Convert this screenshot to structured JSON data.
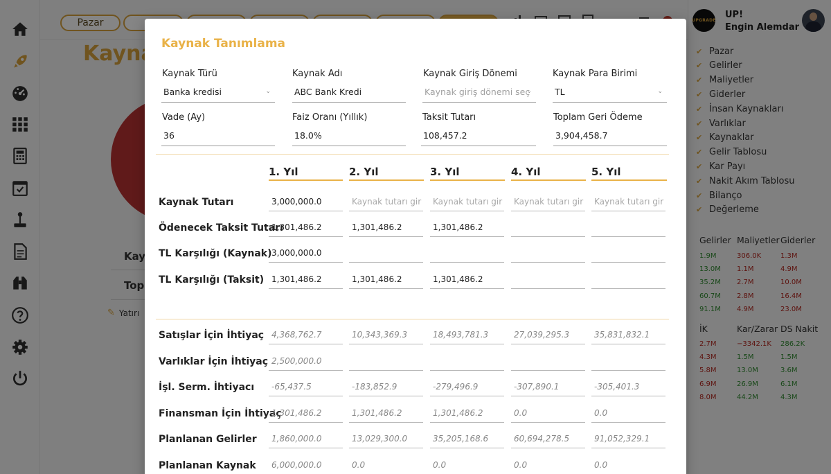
{
  "app": {
    "org": "UP!",
    "user_name": "Engin Alemdar",
    "logo_text": "UPGRADE"
  },
  "top_tabs": [
    {
      "label": "Pazar"
    },
    {
      "label": ""
    },
    {
      "label": ""
    },
    {
      "label": ""
    },
    {
      "label": ""
    },
    {
      "label": ""
    },
    {
      "label": ""
    }
  ],
  "background": {
    "title": "Kaynak",
    "text1": "Kay",
    "text2": "Topl",
    "text3": "Yatırı"
  },
  "sidebar_nav": [
    {
      "label": "Pazar"
    },
    {
      "label": "Gelirler"
    },
    {
      "label": "Maliyetler"
    },
    {
      "label": "Giderler"
    },
    {
      "label": "İnsan Kaynakları"
    },
    {
      "label": "Varlıklar"
    },
    {
      "label": "Kaynaklar"
    },
    {
      "label": "Gelir Tablosu"
    },
    {
      "label": "Kar Payı"
    },
    {
      "label": "Nakit Akım Tablosu"
    },
    {
      "label": "Bilanço"
    },
    {
      "label": "Değerleme"
    }
  ],
  "summary1": {
    "headers": [
      "Gelirler",
      "Maliyetler",
      "Giderler"
    ],
    "col1": [
      "1.9M",
      "13.0M",
      "35.2M",
      "60.7M",
      "91.1M"
    ],
    "col2": [
      "306.0K",
      "1.1M",
      "2.7M",
      "2.8M",
      "4.9M"
    ],
    "col3": [
      "1.3M",
      "4.9M",
      "10.0M",
      "16.4M",
      "23.0M"
    ]
  },
  "summary2": {
    "headers": [
      "İK",
      "Kar/Zarar",
      "DS Nakit"
    ],
    "col1": [
      "2.7M",
      "4.3M",
      "5.8M",
      "6.9M",
      "8.0M"
    ],
    "col2": [
      "−3342.1K",
      "1.5M",
      "13.0M",
      "26.9M",
      "44.2M"
    ],
    "col3": [
      "286.2K",
      "1.5M",
      "3.6M",
      "6.1M",
      "4.3M"
    ]
  },
  "colors": {
    "accent": "#e9b248",
    "green": "#2f8a2f",
    "red": "#b3261e"
  },
  "modal": {
    "title": "Kaynak Tanımlama",
    "fields": {
      "kaynak_turu": {
        "label": "Kaynak Türü",
        "value": "Banka kredisi"
      },
      "kaynak_adi": {
        "label": "Kaynak Adı",
        "value": "ABC Bank Kredi"
      },
      "giris_donemi": {
        "label": "Kaynak Giriş Dönemi",
        "placeholder": "Kaynak giriş dönemi seç"
      },
      "para_birimi": {
        "label": "Kaynak Para Birimi",
        "value": "TL"
      },
      "vade": {
        "label": "Vade (Ay)",
        "value": "36"
      },
      "faiz": {
        "label": "Faiz Oranı (Yıllık)",
        "value": "18.0%"
      },
      "taksit": {
        "label": "Taksit Tutarı",
        "value": "108,457.2"
      },
      "toplam": {
        "label": "Toplam Geri Ödeme",
        "value": "3,904,458.7"
      }
    },
    "years": [
      "1. Yıl",
      "2. Yıl",
      "3. Yıl",
      "4. Yıl",
      "5. Yıl"
    ],
    "input_rows": [
      {
        "label": "Kaynak Tutarı",
        "cells": [
          "3,000,000.0",
          "",
          "",
          "",
          ""
        ],
        "placeholder": "Kaynak tutarı gir"
      },
      {
        "label": "Ödenecek Taksit Tutarı",
        "cells": [
          "1,301,486.2",
          "1,301,486.2",
          "1,301,486.2",
          "",
          ""
        ]
      },
      {
        "label": "TL Karşılığı (Kaynak)",
        "cells": [
          "3,000,000.0",
          "",
          "",
          "",
          ""
        ]
      },
      {
        "label": "TL Karşılığı (Taksit)",
        "cells": [
          "1,301,486.2",
          "1,301,486.2",
          "1,301,486.2",
          "",
          ""
        ]
      }
    ],
    "calc_rows": [
      {
        "label": "Satışlar İçin İhtiyaç",
        "cells": [
          "4,368,762.7",
          "10,343,369.3",
          "18,493,781.3",
          "27,039,295.3",
          "35,831,832.1"
        ]
      },
      {
        "label": "Varlıklar İçin İhtiyaç",
        "cells": [
          "2,500,000.0",
          "",
          "",
          "",
          ""
        ]
      },
      {
        "label": "İşl. Serm. İhtiyacı",
        "cells": [
          "-65,437.5",
          "-183,852.9",
          "-279,496.9",
          "-307,890.1",
          "-305,401.3"
        ]
      },
      {
        "label": "Finansman İçin İhtiyaç",
        "cells": [
          "1,301,486.2",
          "1,301,486.2",
          "1,301,486.2",
          "0.0",
          "0.0"
        ]
      },
      {
        "label": "Planlanan Gelirler",
        "cells": [
          "1,860,000.0",
          "13,029,300.0",
          "35,205,168.6",
          "60,694,278.5",
          "91,052,329.1"
        ]
      },
      {
        "label": "Planlanan Kaynak",
        "cells": [
          "6,000,000.0",
          "0.0",
          "0.0",
          "0.0",
          "0.0"
        ]
      }
    ]
  }
}
